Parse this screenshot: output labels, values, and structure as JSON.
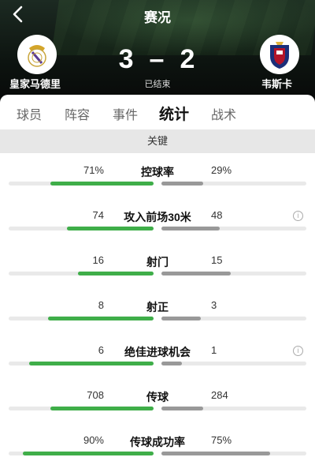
{
  "header": {
    "title": "赛况",
    "home_team": "皇家马德里",
    "away_team": "韦斯卡",
    "home_score": "3",
    "separator": "–",
    "away_score": "2",
    "status": "已结束"
  },
  "tabs": [
    "球员",
    "阵容",
    "事件",
    "统计",
    "战术"
  ],
  "active_tab": "统计",
  "section": {
    "title": "关键"
  },
  "colors": {
    "home_bar": "#3fae49",
    "away_bar": "#999999"
  },
  "stats": [
    {
      "name": "控球率",
      "home": "71%",
      "away": "29%",
      "home_ratio": 0.71,
      "away_ratio": 0.29,
      "info": false
    },
    {
      "name": "攻入前场30米",
      "home": "74",
      "away": "48",
      "home_ratio": 0.6,
      "away_ratio": 0.4,
      "info": true,
      "info_icon": "i"
    },
    {
      "name": "射门",
      "home": "16",
      "away": "15",
      "home_ratio": 0.52,
      "away_ratio": 0.48,
      "info": false
    },
    {
      "name": "射正",
      "home": "8",
      "away": "3",
      "home_ratio": 0.73,
      "away_ratio": 0.27,
      "info": false
    },
    {
      "name": "绝佳进球机会",
      "home": "6",
      "away": "1",
      "home_ratio": 0.86,
      "away_ratio": 0.14,
      "info": true,
      "info_icon": "i"
    },
    {
      "name": "传球",
      "home": "708",
      "away": "284",
      "home_ratio": 0.71,
      "away_ratio": 0.29,
      "info": false
    },
    {
      "name": "传球成功率",
      "home": "90%",
      "away": "75%",
      "home_ratio": 0.9,
      "away_ratio": 0.75,
      "info": false
    }
  ]
}
